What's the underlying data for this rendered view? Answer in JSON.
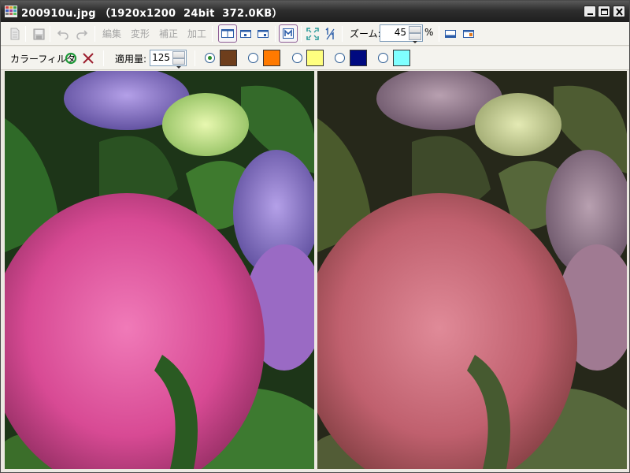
{
  "window": {
    "title": "200910u.jpg （1920x1200  24bit  372.0KB）",
    "icon": "grid-app-icon"
  },
  "titlebar_buttons": {
    "minimize": "minimize-icon",
    "maximize": "maximize-icon",
    "close": "close-icon"
  },
  "toolbar": {
    "icons": [
      "file-icon",
      "save-icon",
      "undo-icon",
      "redo-icon"
    ],
    "menus": [
      "編集",
      "変形",
      "補正",
      "加工"
    ],
    "view_buttons": [
      "split-view-icon",
      "before-view-icon",
      "after-view-icon",
      "m-mode-icon",
      "fit-window-icon",
      "actual-size-icon"
    ],
    "zoom_label": "ズーム:",
    "zoom_value": "45",
    "zoom_unit": "%",
    "layout_icons": [
      "horizontal-layout-icon",
      "vertical-layout-icon"
    ]
  },
  "filterbar": {
    "label": "カラーフィルタ",
    "enable_icon": "circle-ok-icon",
    "disable_icon": "x-cancel-icon",
    "amount_label": "適用量:",
    "amount_value": "125",
    "swatches": [
      {
        "name": "brown",
        "color": "#6e3e1c",
        "selected": true
      },
      {
        "name": "orange",
        "color": "#ff7a00",
        "selected": false
      },
      {
        "name": "yellow",
        "color": "#ffff7f",
        "selected": false
      },
      {
        "name": "navy",
        "color": "#000a80",
        "selected": false
      },
      {
        "name": "cyan",
        "color": "#7fffff",
        "selected": false
      }
    ]
  },
  "viewer": {
    "left_label": "original-image",
    "right_label": "filtered-image"
  }
}
